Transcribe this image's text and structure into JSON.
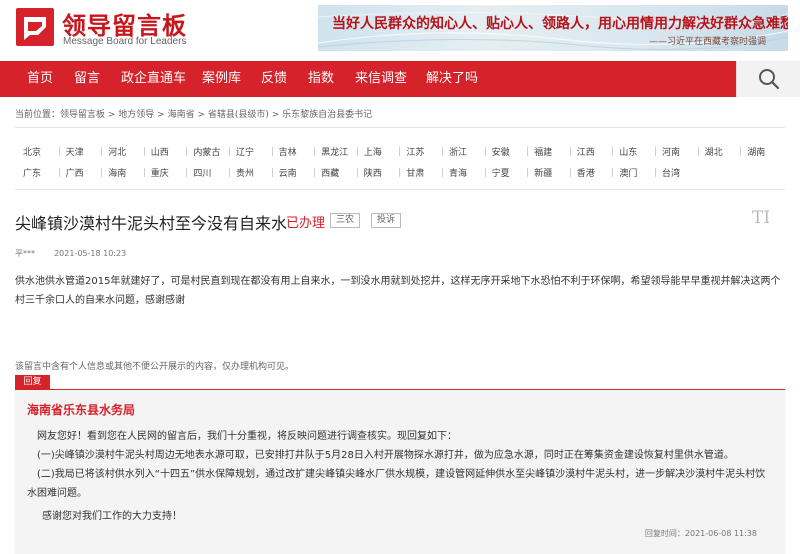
{
  "header": {
    "logo_title": "领导留言板",
    "logo_subtitle": "Message Board for Leaders",
    "banner_quote": "当好人民群众的知心人、贴心人、领路人，用心用情用力解决好群众急难愁盼问题。",
    "banner_author": "——习近平在西藏考察时强调"
  },
  "nav": {
    "items": [
      {
        "label": "首页"
      },
      {
        "label": "留言"
      },
      {
        "label": "政企直通车"
      },
      {
        "label": "案例库"
      },
      {
        "label": "反馈"
      },
      {
        "label": "指数"
      },
      {
        "label": "来信调查"
      },
      {
        "label": "解决了吗"
      }
    ],
    "search_icon": "search-icon"
  },
  "breadcrumb": {
    "prefix": "当前位置：",
    "items": [
      "领导留言板",
      "地方领导",
      "海南省",
      "省辖县(县级市)",
      "乐东黎族自治县委书记"
    ],
    "separator": " > "
  },
  "regions": {
    "row1": [
      "北京",
      "天津",
      "河北",
      "山西",
      "内蒙古",
      "辽宁",
      "吉林",
      "黑龙江",
      "上海",
      "江苏",
      "浙江",
      "安徽",
      "福建",
      "江西",
      "山东",
      "河南",
      "湖北",
      "湖南"
    ],
    "row2": [
      "广东",
      "广西",
      "海南",
      "重庆",
      "四川",
      "贵州",
      "云南",
      "西藏",
      "陕西",
      "甘肃",
      "青海",
      "宁夏",
      "新疆",
      "香港",
      "澳门",
      "台湾"
    ]
  },
  "message": {
    "title": "尖峰镇沙漠村牛泥头村至今没有自来水",
    "status": "已办理",
    "category": "三农",
    "complaint": "投诉",
    "font_toggle": "TI",
    "author": "平***",
    "time": "2021-05-18 10:23",
    "body": "供水池供水管道2015年就建好了，可是村民直到现在都没有用上自来水，一到没水用就到处挖井，这样无序开采地下水恐怕不利于环保啊，希望领导能早早重视并解决这两个村三千余口人的自来水问题，感谢感谢",
    "privacy_notice": "该留言中含有个人信息或其他不便公开展示的内容，仅办理机构可见。"
  },
  "reply": {
    "badge": "回复",
    "org": "海南省乐东县水务局",
    "paragraphs": [
      "网友您好！看到您在人民网的留言后，我们十分重视，将反映问题进行调查核实。现回复如下：",
      "(一)尖峰镇沙漠村牛泥头村周边无地表水源可取，已安排打井队于5月28日入村开展物探水源打井，做为应急水源，同时正在筹集资金建设恢复村里供水管道。",
      "(二)我局已将该村供水列入“十四五”供水保障规划，通过改扩建尖峰镇尖峰水厂供水规模，建设管网延伸供水至尖峰镇沙漠村牛泥头村，进一步解决沙漠村牛泥头村饮水困难问题。",
      "感谢您对我们工作的大力支持！"
    ],
    "date": "回复时间：2021-06-08 11:38"
  },
  "colors": {
    "brand_red": "#d6222b",
    "reply_bg": "#f4f4f4"
  }
}
